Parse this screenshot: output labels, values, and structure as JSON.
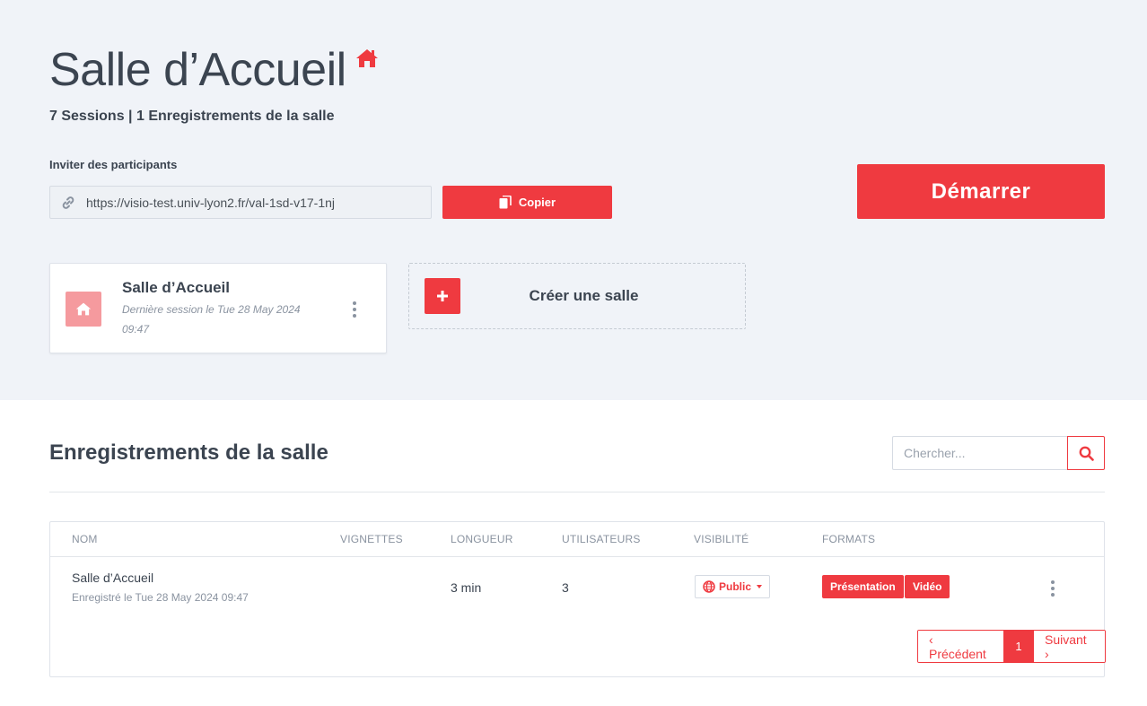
{
  "room": {
    "title": "Salle d’Accueil",
    "stats": "7 Sessions | 1 Enregistrements de la salle"
  },
  "invite": {
    "label": "Inviter des participants",
    "url": "https://visio-test.univ-lyon2.fr/val-1sd-v17-1nj",
    "copy_label": "Copier"
  },
  "start_label": "Démarrer",
  "room_card": {
    "name": "Salle d’Accueil",
    "last_session": "Dernière session le Tue 28 May 2024 09:47"
  },
  "create_label": "Créer une salle",
  "recordings": {
    "title": "Enregistrements de la salle",
    "search_placeholder": "Chercher...",
    "columns": [
      "Nom",
      "Vignettes",
      "Longueur",
      "Utilisateurs",
      "Visibilité",
      "Formats"
    ],
    "rows": [
      {
        "name": "Salle d’Accueil",
        "recorded": "Enregistré le Tue 28 May 2024 09:47",
        "length": "3 min",
        "users": "3",
        "visibility": "Public",
        "formats": [
          "Présentation",
          "Vidéo"
        ]
      }
    ]
  },
  "pagination": {
    "prev": "‹ Précédent",
    "current": "1",
    "next": "Suivant ›"
  },
  "colors": {
    "accent": "#ef3a40",
    "accent_light": "#f59a9e",
    "header_bg": "#f0f3f8",
    "text_dark": "#3b4450",
    "text_muted": "#8a93a0"
  }
}
